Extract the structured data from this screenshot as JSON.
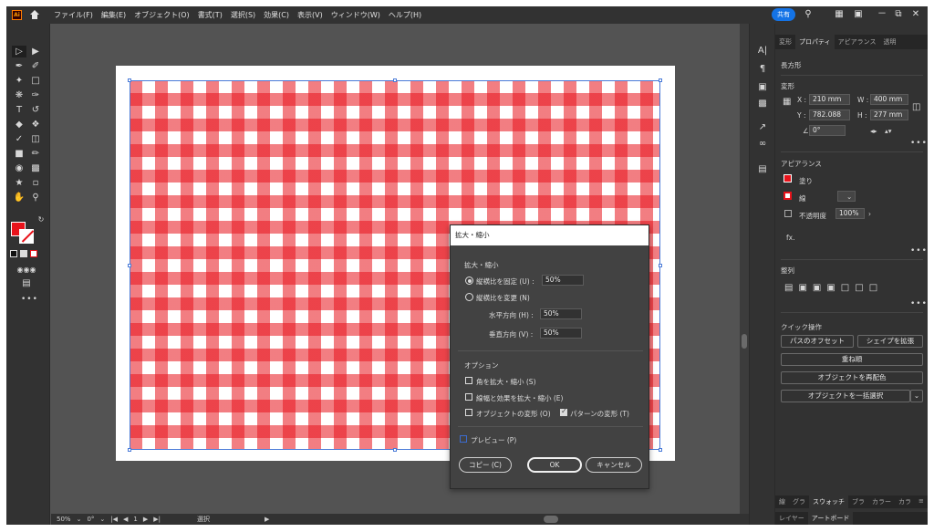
{
  "menubar": {
    "logo": "Ai",
    "items": [
      "ファイル(F)",
      "編集(E)",
      "オブジェクト(O)",
      "書式(T)",
      "選択(S)",
      "効果(C)",
      "表示(V)",
      "ウィンドウ(W)",
      "ヘルプ(H)"
    ],
    "share": "共有",
    "win_minimize": "－",
    "win_restore": "⧉",
    "win_close": "✕"
  },
  "status": {
    "zoom": "50%",
    "angle": "0°",
    "artboard": "1",
    "tool": "選択"
  },
  "panel": {
    "tabs": [
      "変形",
      "プロパティ",
      "アピアランス",
      "透明"
    ],
    "object_type": "長方形",
    "transform": {
      "title": "変形",
      "x_label": "X :",
      "x": "210 mm",
      "y_label": "Y :",
      "y": "782.088",
      "w_label": "W :",
      "w": "400 mm",
      "h_label": "H :",
      "h": "277 mm",
      "angle": "0°"
    },
    "appearance": {
      "title": "アピアランス",
      "fill": "塗り",
      "stroke": "線",
      "opacity_label": "不透明度",
      "opacity": "100%",
      "fx": "fx."
    },
    "align": {
      "title": "整列"
    },
    "quick": {
      "title": "クイック操作",
      "offset_path": "パスのオフセット",
      "expand_shape": "シェイプを拡張",
      "arrange": "重ね順",
      "recolor": "オブジェクトを再配色",
      "select_all": "オブジェクトを一括選択"
    },
    "bottom_tabs_1": [
      "線",
      "グラ",
      "スウォッチ",
      "ブラ",
      "カラー",
      "カラ"
    ],
    "bottom_tabs_2": [
      "レイヤー",
      "アートボード"
    ]
  },
  "dialog": {
    "title": "拡大・縮小",
    "section_scale": "拡大・縮小",
    "uniform_label": "縦横比を固定 (U) :",
    "uniform_value": "50%",
    "nonuniform_label": "縦横比を変更 (N)",
    "horizontal_label": "水平方向 (H) :",
    "horizontal_value": "50%",
    "vertical_label": "垂直方向 (V) :",
    "vertical_value": "50%",
    "section_options": "オプション",
    "opt_corners": "角を拡大・縮小 (S)",
    "opt_strokes": "線幅と効果を拡大・縮小 (E)",
    "opt_objects": "オブジェクトの変形 (O)",
    "opt_patterns": "パターンの変形 (T)",
    "preview": "プレビュー (P)",
    "copy": "コピー (C)",
    "ok": "OK",
    "cancel": "キャンセル"
  }
}
